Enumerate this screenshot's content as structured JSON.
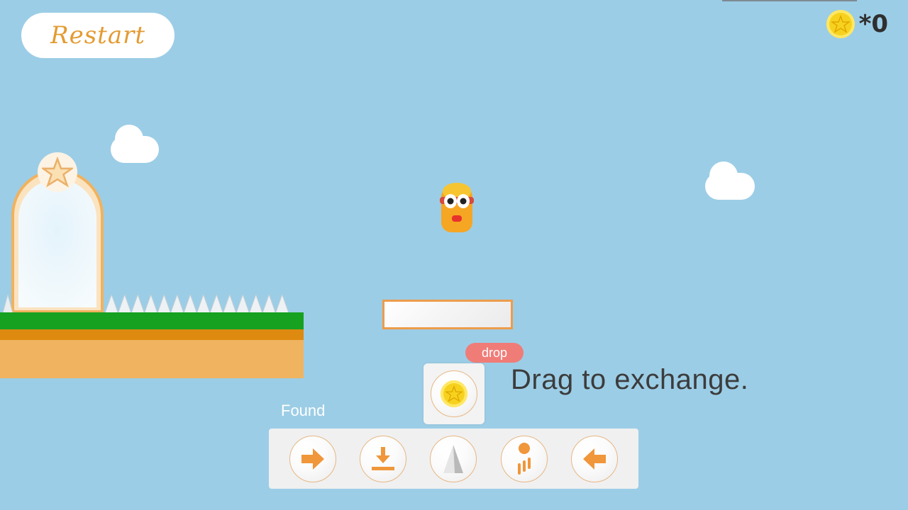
{
  "header": {
    "restart_label": "Restart",
    "coin_count": "*0"
  },
  "drop": {
    "label": "drop",
    "hint": "Drag to exchange."
  },
  "inventory": {
    "label": "Found",
    "items": [
      {
        "name": "right-arrow",
        "icon": "arrow-right-icon"
      },
      {
        "name": "download",
        "icon": "download-icon"
      },
      {
        "name": "spike",
        "icon": "spike-icon"
      },
      {
        "name": "jump",
        "icon": "jump-icon"
      },
      {
        "name": "left-arrow",
        "icon": "arrow-left-icon"
      }
    ]
  },
  "colors": {
    "sky": "#9ccde6",
    "accent": "#ed9c4a",
    "grass": "#16a121",
    "coin": "#f6d21f",
    "drop_badge": "#f07c78"
  }
}
